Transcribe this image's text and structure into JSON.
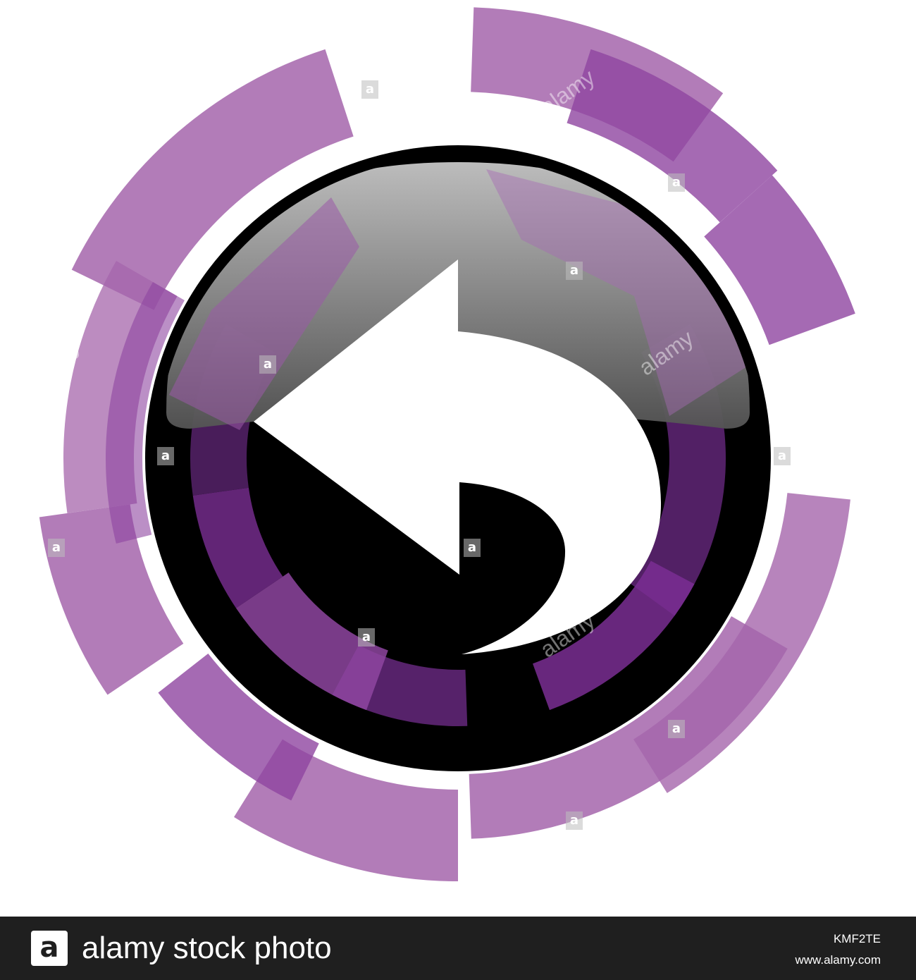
{
  "icon": {
    "name": "reply-arrow-icon",
    "colors": {
      "ring_light": "#a565ab",
      "ring_mid": "#8e45a0",
      "ring_dark": "#5b2470",
      "accent": "#7a2e93",
      "disc": "#000000",
      "gloss_top": "#bcbcbc",
      "gloss_bottom": "#5a5a5a",
      "arrow": "#ffffff"
    }
  },
  "watermark": {
    "logo_letter": "a",
    "overlay_word": "alamy"
  },
  "footer": {
    "brand": "alamy stock photo",
    "image_id": "KMF2TE",
    "url": "www.alamy.com"
  }
}
